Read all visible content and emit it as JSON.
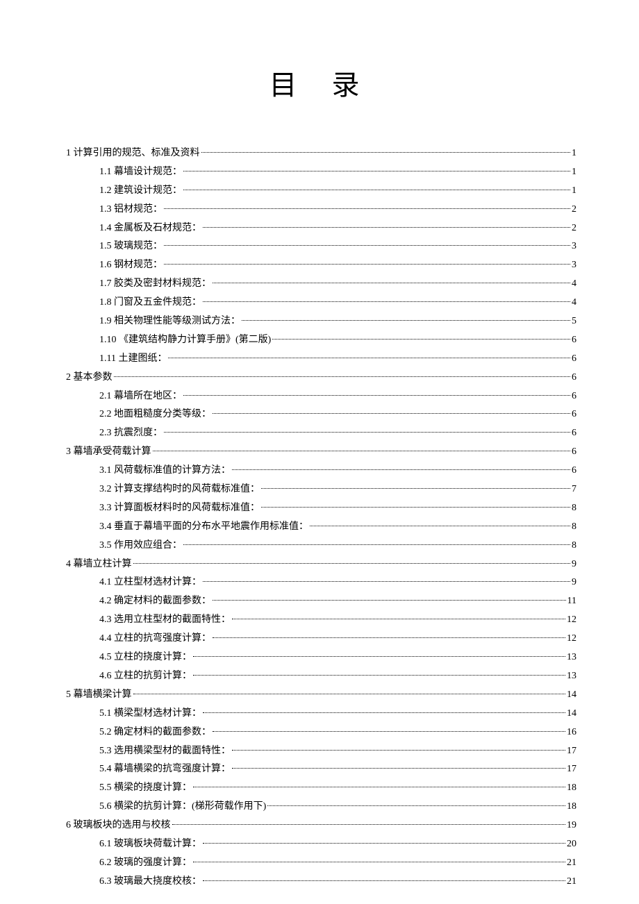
{
  "title": "目 录",
  "toc": [
    {
      "level": 0,
      "num": "1",
      "text": "计算引用的规范、标准及资料",
      "page": "1"
    },
    {
      "level": 1,
      "num": "1.1",
      "text": "幕墙设计规范：",
      "page": "1"
    },
    {
      "level": 1,
      "num": "1.2",
      "text": "建筑设计规范：",
      "page": "1"
    },
    {
      "level": 1,
      "num": "1.3",
      "text": "铝材规范：",
      "page": "2"
    },
    {
      "level": 1,
      "num": "1.4",
      "text": "金属板及石材规范：",
      "page": "2"
    },
    {
      "level": 1,
      "num": "1.5",
      "text": "玻璃规范：",
      "page": "3"
    },
    {
      "level": 1,
      "num": "1.6",
      "text": "钢材规范：",
      "page": "3"
    },
    {
      "level": 1,
      "num": "1.7",
      "text": "胶类及密封材料规范：",
      "page": "4"
    },
    {
      "level": 1,
      "num": "1.8",
      "text": "门窗及五金件规范：",
      "page": "4"
    },
    {
      "level": 1,
      "num": "1.9",
      "text": "相关物理性能等级测试方法：",
      "page": "5"
    },
    {
      "level": 1,
      "num": "1.10",
      "text": " 《建筑结构静力计算手册》(第二版)",
      "page": "6"
    },
    {
      "level": 1,
      "num": "1.11",
      "text": "土建图纸：",
      "page": "6"
    },
    {
      "level": 0,
      "num": "2",
      "text": "基本参数",
      "page": "6"
    },
    {
      "level": 1,
      "num": "2.1",
      "text": "幕墙所在地区：",
      "page": "6"
    },
    {
      "level": 1,
      "num": "2.2",
      "text": "地面粗糙度分类等级：",
      "page": "6"
    },
    {
      "level": 1,
      "num": "2.3",
      "text": "抗震烈度：",
      "page": "6"
    },
    {
      "level": 0,
      "num": "3",
      "text": "幕墙承受荷载计算",
      "page": "6"
    },
    {
      "level": 1,
      "num": "3.1",
      "text": "风荷载标准值的计算方法：",
      "page": "6"
    },
    {
      "level": 1,
      "num": "3.2",
      "text": "计算支撑结构时的风荷载标准值：",
      "page": "7"
    },
    {
      "level": 1,
      "num": "3.3",
      "text": "计算面板材料时的风荷载标准值：",
      "page": "8"
    },
    {
      "level": 1,
      "num": "3.4",
      "text": "垂直于幕墙平面的分布水平地震作用标准值：",
      "page": "8"
    },
    {
      "level": 1,
      "num": "3.5",
      "text": "作用效应组合：",
      "page": "8"
    },
    {
      "level": 0,
      "num": "4",
      "text": "幕墙立柱计算",
      "page": "9"
    },
    {
      "level": 1,
      "num": "4.1",
      "text": "立柱型材选材计算：",
      "page": "9"
    },
    {
      "level": 1,
      "num": "4.2",
      "text": "确定材料的截面参数：",
      "page": "11"
    },
    {
      "level": 1,
      "num": "4.3",
      "text": "选用立柱型材的截面特性：",
      "page": "12"
    },
    {
      "level": 1,
      "num": "4.4",
      "text": "立柱的抗弯强度计算：",
      "page": "12"
    },
    {
      "level": 1,
      "num": "4.5",
      "text": "立柱的挠度计算：",
      "page": "13"
    },
    {
      "level": 1,
      "num": "4.6",
      "text": "立柱的抗剪计算：",
      "page": "13"
    },
    {
      "level": 0,
      "num": "5",
      "text": "幕墙横梁计算",
      "page": "14"
    },
    {
      "level": 1,
      "num": "5.1",
      "text": "横梁型材选材计算：",
      "page": "14"
    },
    {
      "level": 1,
      "num": "5.2",
      "text": "确定材料的截面参数：",
      "page": "16"
    },
    {
      "level": 1,
      "num": "5.3",
      "text": "选用横梁型材的截面特性：",
      "page": "17"
    },
    {
      "level": 1,
      "num": "5.4",
      "text": "幕墙横梁的抗弯强度计算：",
      "page": "17"
    },
    {
      "level": 1,
      "num": "5.5",
      "text": "横梁的挠度计算：",
      "page": "18"
    },
    {
      "level": 1,
      "num": "5.6",
      "text": "横梁的抗剪计算：(梯形荷载作用下)",
      "page": "18"
    },
    {
      "level": 0,
      "num": "6",
      "text": "玻璃板块的选用与校核",
      "page": "19"
    },
    {
      "level": 1,
      "num": "6.1",
      "text": "玻璃板块荷载计算：",
      "page": "20"
    },
    {
      "level": 1,
      "num": "6.2",
      "text": "玻璃的强度计算：",
      "page": "21"
    },
    {
      "level": 1,
      "num": "6.3",
      "text": "玻璃最大挠度校核：",
      "page": "21"
    }
  ]
}
